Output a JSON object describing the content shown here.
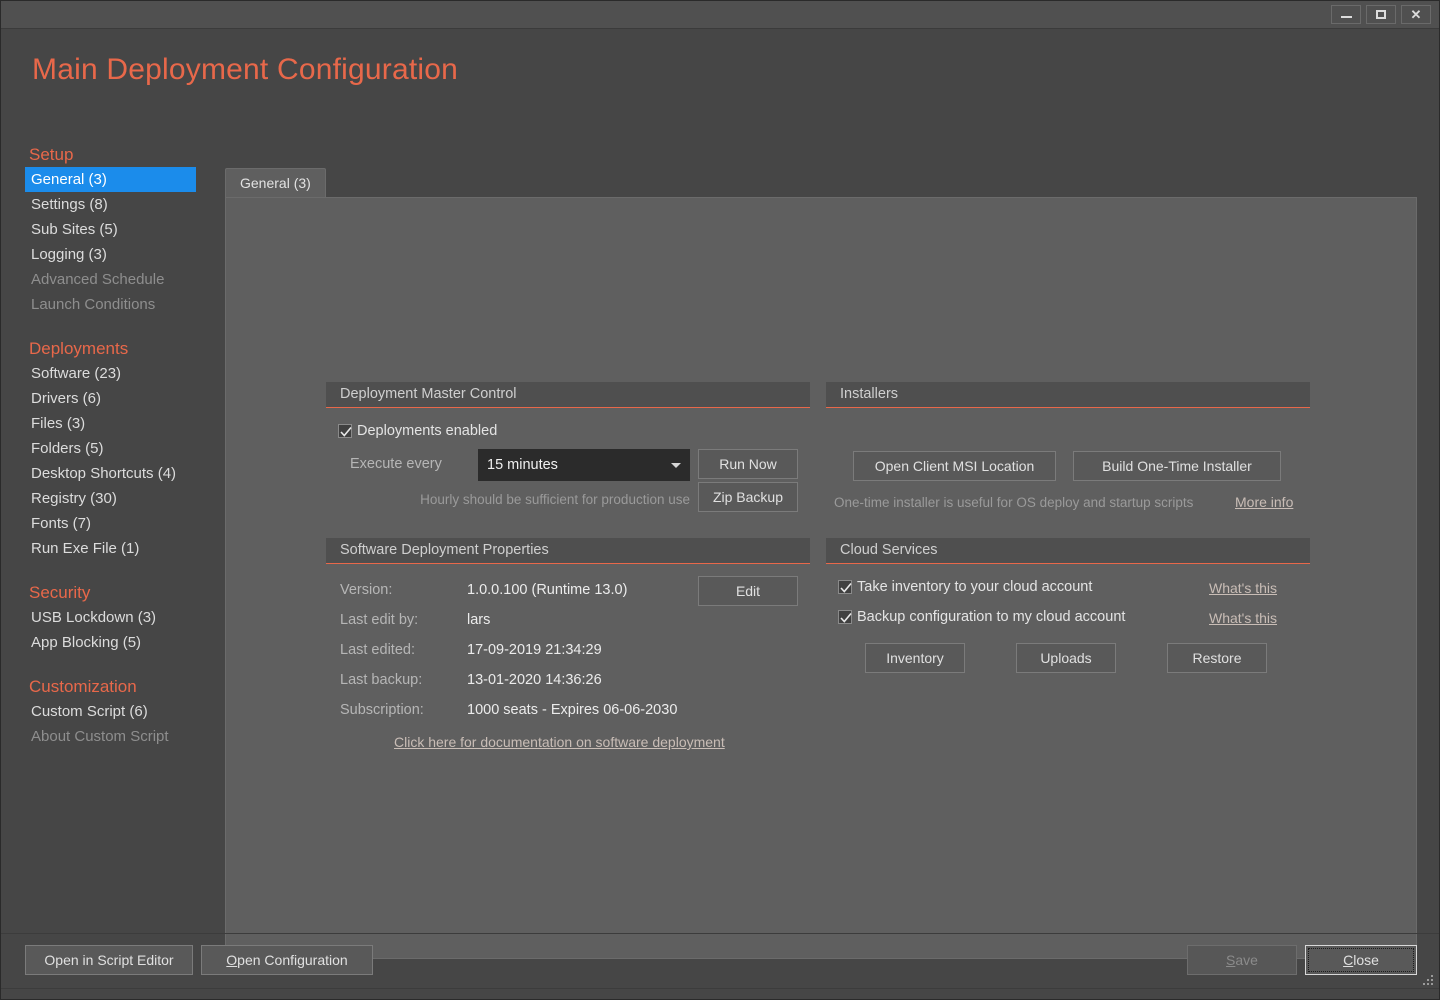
{
  "window": {
    "controls": [
      {
        "name": "minimize",
        "glyph": "minimize-icon"
      },
      {
        "name": "maximize",
        "glyph": "maximize-icon"
      },
      {
        "name": "close",
        "glyph": "close-icon"
      }
    ]
  },
  "page_title": "Main Deployment Configuration",
  "sidebar": {
    "sections": [
      {
        "title": "Setup",
        "items": [
          {
            "label": "General (3)",
            "state": "selected"
          },
          {
            "label": "Settings (8)",
            "state": "normal"
          },
          {
            "label": "Sub Sites (5)",
            "state": "normal"
          },
          {
            "label": "Logging (3)",
            "state": "normal"
          },
          {
            "label": "Advanced Schedule",
            "state": "disabled"
          },
          {
            "label": "Launch Conditions",
            "state": "disabled"
          }
        ]
      },
      {
        "title": "Deployments",
        "items": [
          {
            "label": "Software (23)",
            "state": "normal"
          },
          {
            "label": "Drivers (6)",
            "state": "normal"
          },
          {
            "label": "Files (3)",
            "state": "normal"
          },
          {
            "label": "Folders (5)",
            "state": "normal"
          },
          {
            "label": "Desktop Shortcuts (4)",
            "state": "normal"
          },
          {
            "label": "Registry (30)",
            "state": "normal"
          },
          {
            "label": "Fonts (7)",
            "state": "normal"
          },
          {
            "label": "Run Exe File (1)",
            "state": "normal"
          }
        ]
      },
      {
        "title": "Security",
        "items": [
          {
            "label": "USB Lockdown (3)",
            "state": "normal"
          },
          {
            "label": "App Blocking (5)",
            "state": "normal"
          }
        ]
      },
      {
        "title": "Customization",
        "items": [
          {
            "label": "Custom Script (6)",
            "state": "normal"
          },
          {
            "label": "About Custom Script",
            "state": "disabled"
          }
        ]
      }
    ]
  },
  "tabs": [
    {
      "label": "General (3)",
      "active": true
    }
  ],
  "master_control": {
    "title": "Deployment Master Control",
    "enabled_label": "Deployments enabled",
    "enabled_checked": true,
    "execute_every_label": "Execute every",
    "interval_value": "15 minutes",
    "hint": "Hourly should be sufficient for production use",
    "run_now_label": "Run Now",
    "zip_backup_label": "Zip Backup"
  },
  "installers": {
    "title": "Installers",
    "open_msi_label": "Open Client MSI Location",
    "build_installer_label": "Build One-Time Installer",
    "hint": "One-time installer is useful for OS deploy and startup scripts",
    "more_info_label": "More info"
  },
  "deployment_properties": {
    "title": "Software Deployment Properties",
    "edit_label": "Edit",
    "rows": [
      {
        "label": "Version:",
        "value": "1.0.0.100 (Runtime 13.0)"
      },
      {
        "label": "Last edit by:",
        "value": "lars"
      },
      {
        "label": "Last edited:",
        "value": "17-09-2019 21:34:29"
      },
      {
        "label": "Last backup:",
        "value": "13-01-2020 14:36:26"
      },
      {
        "label": "Subscription:",
        "value": "1000 seats  -  Expires 06-06-2030"
      }
    ],
    "doc_link": "Click here for documentation on software deployment"
  },
  "cloud_services": {
    "title": "Cloud Services",
    "checkboxes": [
      {
        "label": "Take inventory to your cloud account",
        "checked": true,
        "help": "What's this"
      },
      {
        "label": "Backup configuration to my cloud account",
        "checked": true,
        "help": "What's this"
      }
    ],
    "buttons": [
      {
        "label": "Inventory"
      },
      {
        "label": "Uploads"
      },
      {
        "label": "Restore"
      }
    ]
  },
  "footer": {
    "script_editor_label": "Open in Script Editor",
    "open_config_label": "Open Configuration",
    "open_config_accel": "O",
    "save_label": "Save",
    "save_accel": "S",
    "save_disabled": true,
    "close_label": "Close",
    "close_accel": "C"
  },
  "colors": {
    "accent": "#e8684a",
    "selection": "#1b8ceb",
    "window_bg": "#464646",
    "panel_bg": "#5f5f5f"
  }
}
